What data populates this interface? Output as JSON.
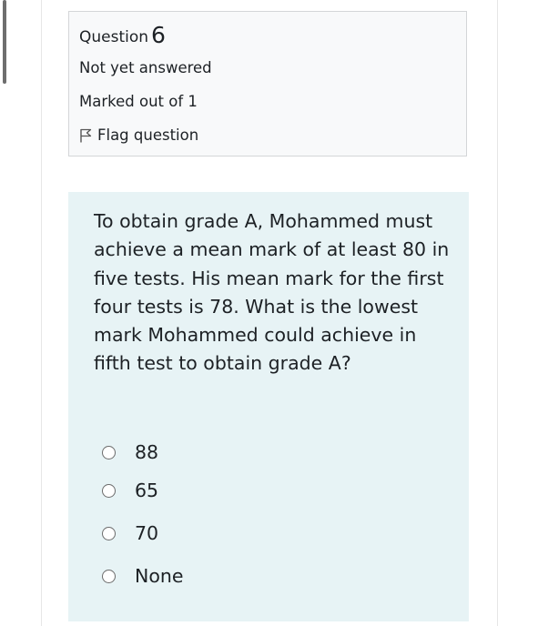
{
  "info": {
    "question_label": "Question",
    "question_number": "6",
    "status": "Not yet answered",
    "marked": "Marked out of 1",
    "flag_label": "Flag question"
  },
  "question": {
    "text": "To obtain grade A, Mohammed must achieve a mean mark of at least 80 in five tests. His mean mark for the first four tests is 78. What is the lowest mark Mohammed could achieve in fifth test to obtain grade A?",
    "options": [
      "88",
      "65",
      "70",
      "None"
    ]
  },
  "icons": {
    "flag": "flag-icon",
    "radio": "radio-circle"
  },
  "colors": {
    "info_bg": "#f8f9fa",
    "question_bg": "#e7f3f5",
    "text": "#1d2125"
  }
}
